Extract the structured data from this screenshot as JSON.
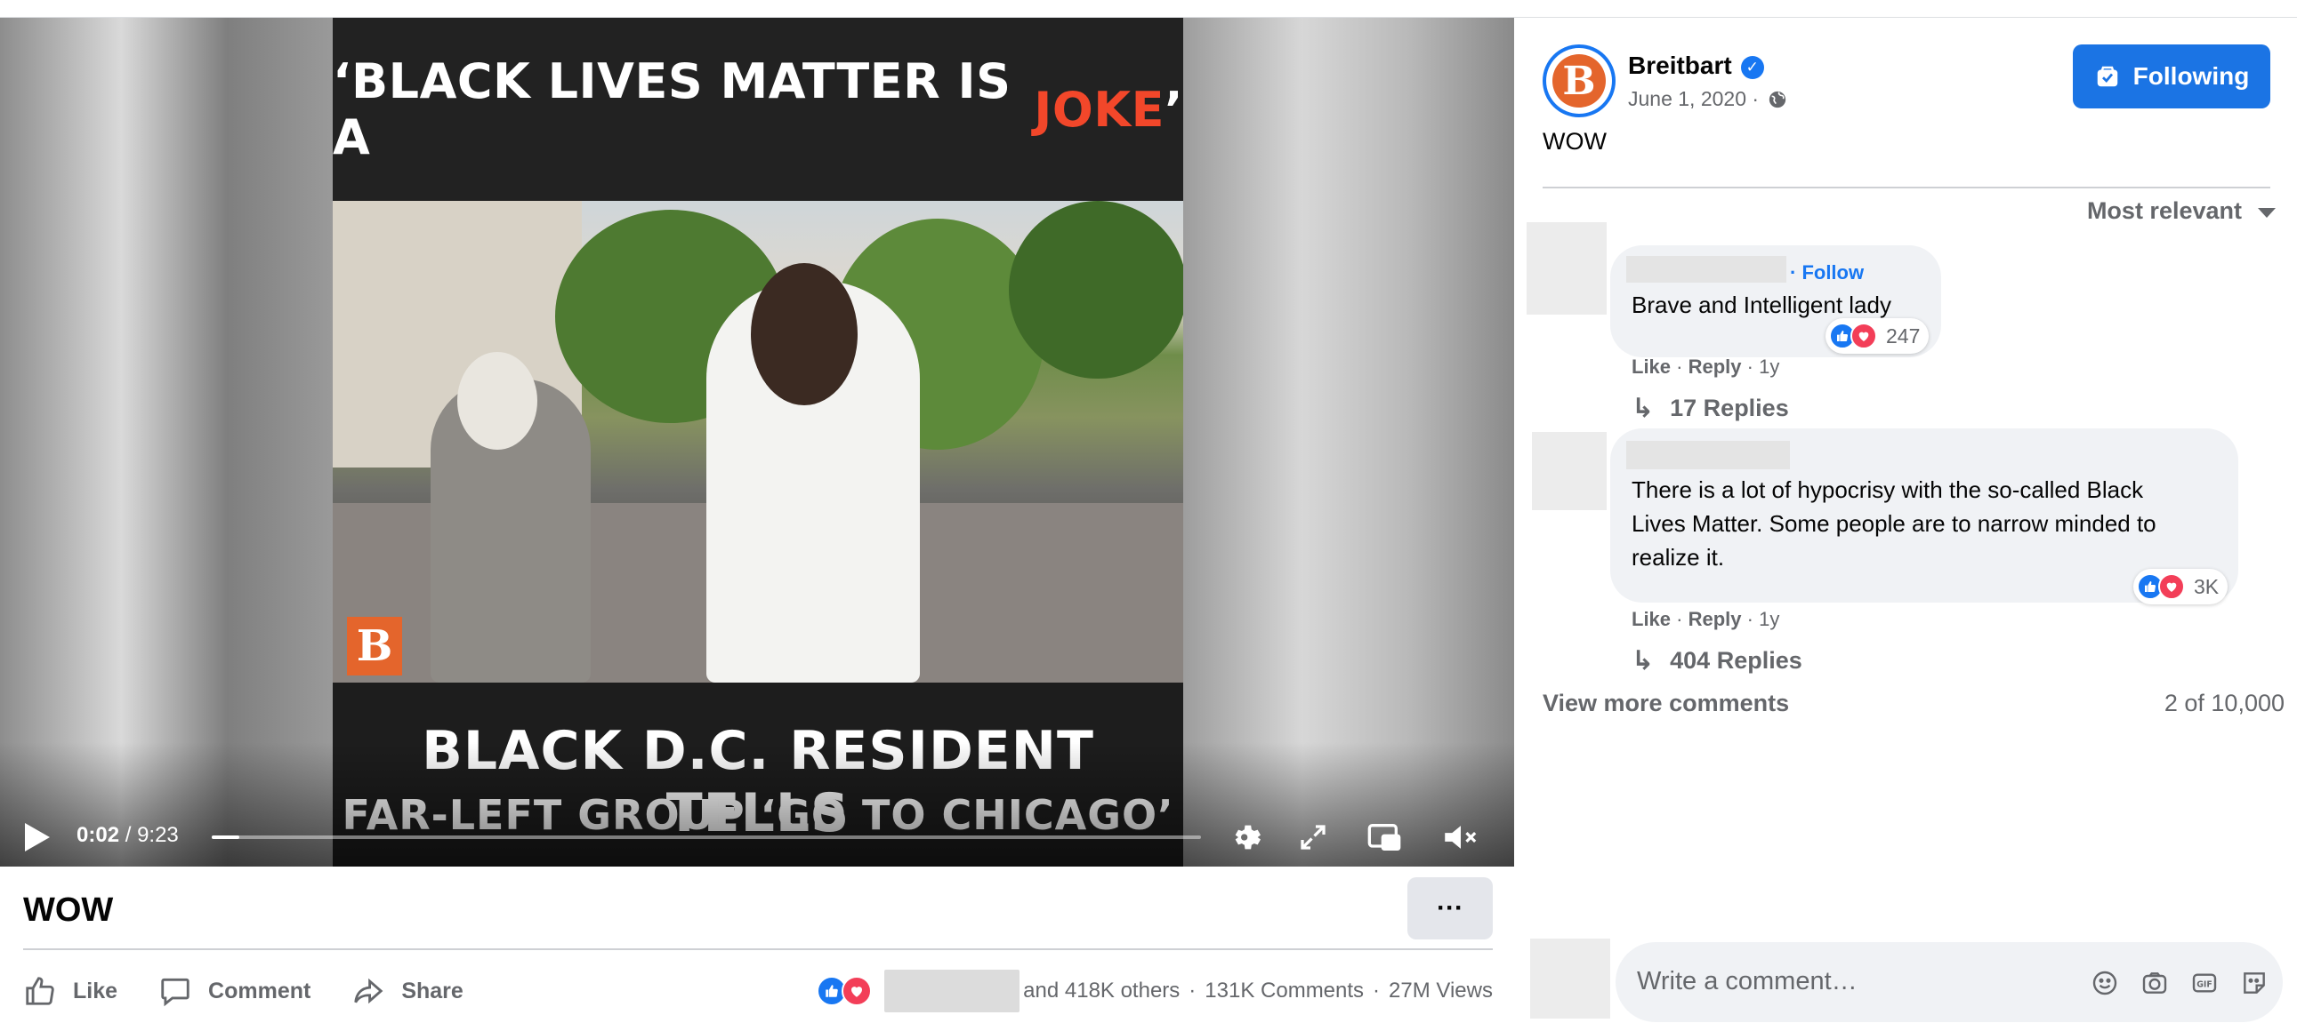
{
  "video": {
    "headline_white": "‘BLACK LIVES MATTER IS A ",
    "headline_red": "JOKE",
    "headline_end": "’",
    "subtitle_line1": "BLACK D.C. RESIDENT TELLS",
    "subtitle_line2": "FAR-LEFT GROUP ‘GO TO CHICAGO’",
    "logo_letter": "B",
    "time_current": "0:02",
    "time_separator": " / ",
    "time_duration": "9:23",
    "progress_fraction": 0.028
  },
  "post": {
    "title": "WOW",
    "more_label": "···",
    "actions": {
      "like": "Like",
      "comment": "Comment",
      "share": "Share"
    },
    "stats": {
      "others": "and 418K others",
      "sep1": "·",
      "comments": "131K Comments",
      "sep2": "·",
      "views": "27M Views"
    }
  },
  "panel": {
    "page_name": "Breitbart",
    "avatar_letter": "B",
    "date": "June 1, 2020 ·",
    "follow_label": "Following",
    "caption": "WOW",
    "sort_label": "Most relevant",
    "comments": [
      {
        "follow": "· Follow",
        "text": "Brave and Intelligent lady",
        "like": "Like",
        "reply": "Reply",
        "age": "1y",
        "dot": "·",
        "reactions": "247",
        "replies": "17 Replies"
      },
      {
        "text_line1": "There is a lot of hypocrisy with the so-called Black",
        "text_line2": "Lives Matter. Some people are to narrow minded to",
        "text_line3": "realize it.",
        "like": "Like",
        "reply": "Reply",
        "age": "1y",
        "dot": "·",
        "reactions": "3K",
        "replies": "404 Replies"
      }
    ],
    "view_more": "View more comments",
    "count": "2 of 10,000",
    "write_placeholder": "Write a comment…"
  },
  "colors": {
    "accent": "#1877f2",
    "follow_button": "#1b74e4",
    "headline_red": "#f2472a",
    "brand_orange": "#e4652c",
    "love": "#f33e58"
  },
  "icons": [
    "play-icon",
    "settings-icon",
    "fullscreen-icon",
    "miniplayer-icon",
    "mute-icon",
    "like-icon",
    "comment-icon",
    "share-icon",
    "verified-icon",
    "globe-icon",
    "following-icon",
    "reply-arrow-icon",
    "emoji-icon",
    "camera-icon",
    "gif-icon",
    "sticker-icon"
  ]
}
